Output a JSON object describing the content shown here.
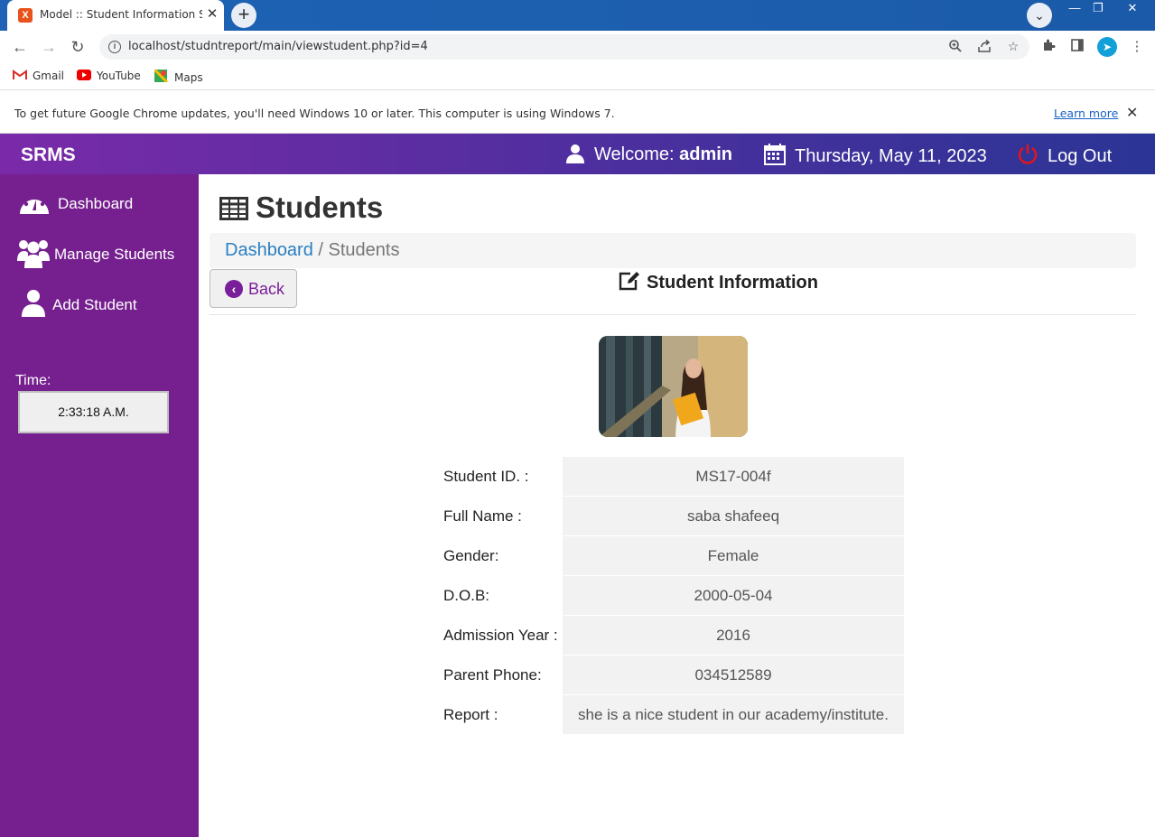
{
  "browser": {
    "tab_title": "Model :: Student Information Sys",
    "tab_favicon": "xampp-icon",
    "url": "localhost/studntreport/main/viewstudent.php?id=4",
    "bookmarks": [
      {
        "label": "Gmail"
      },
      {
        "label": "YouTube"
      },
      {
        "label": "Maps"
      }
    ],
    "infobar_text": "To get future Google Chrome updates, you'll need Windows 10 or later. This computer is using Windows 7.",
    "infobar_link": "Learn more"
  },
  "header": {
    "brand": "SRMS",
    "welcome_prefix": "Welcome: ",
    "welcome_user": "admin",
    "date": "Thursday, May 11, 2023",
    "logout": "Log Out"
  },
  "sidebar": {
    "items": [
      {
        "label": "Dashboard"
      },
      {
        "label": "Manage Students"
      },
      {
        "label": "Add Student"
      }
    ],
    "time_label": "Time:",
    "time_value": "2:33:18 A.M."
  },
  "main": {
    "title": "Students",
    "breadcrumb_link": "Dashboard",
    "breadcrumb_sep": " / ",
    "breadcrumb_current": "Students",
    "back_label": "Back",
    "section_title": "Student Information",
    "fields": [
      {
        "label": "Student ID. :",
        "value": "MS17-004f"
      },
      {
        "label": "Full Name :",
        "value": "saba shafeeq"
      },
      {
        "label": "Gender:",
        "value": "Female"
      },
      {
        "label": "D.O.B:",
        "value": "2000-05-04"
      },
      {
        "label": "Admission Year :",
        "value": "2016"
      },
      {
        "label": "Parent Phone:",
        "value": "034512589"
      },
      {
        "label": "Report :",
        "value": "she is a nice student in our academy/institute."
      }
    ]
  },
  "colors": {
    "sidebar": "#76208f",
    "header_start": "#7a2aa8",
    "header_end": "#2b3595",
    "accent": "#7a1f9a",
    "link": "#2a7fc2"
  }
}
